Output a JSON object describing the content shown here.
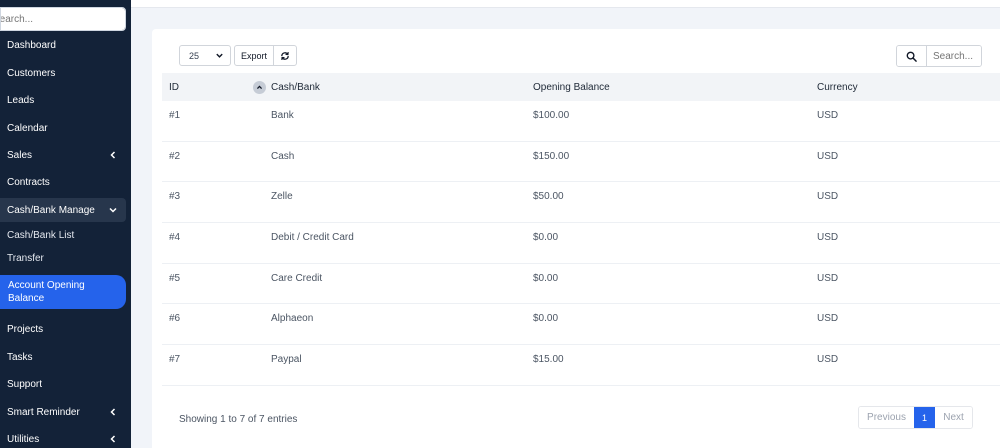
{
  "sidebar": {
    "search_placeholder": "Search...",
    "items": [
      {
        "label": "Dashboard"
      },
      {
        "label": "Customers"
      },
      {
        "label": "Leads"
      },
      {
        "label": "Calendar"
      },
      {
        "label": "Sales"
      },
      {
        "label": "Contracts"
      },
      {
        "label": "Cash/Bank Manage"
      },
      {
        "label": "Projects"
      },
      {
        "label": "Tasks"
      },
      {
        "label": "Support"
      },
      {
        "label": "Smart Reminder"
      },
      {
        "label": "Utilities"
      }
    ],
    "subitems": [
      {
        "label": "Cash/Bank List"
      },
      {
        "label": "Transfer"
      }
    ],
    "active_item": {
      "label": "Account Opening Balance"
    }
  },
  "toolbar": {
    "page_length": "25",
    "export_label": "Export",
    "search_placeholder": "Search..."
  },
  "table": {
    "columns": [
      "ID",
      "Cash/Bank",
      "Opening Balance",
      "Currency"
    ],
    "rows": [
      {
        "id": "#1",
        "cash_bank": "Bank",
        "opening_balance": "$100.00",
        "currency": "USD"
      },
      {
        "id": "#2",
        "cash_bank": "Cash",
        "opening_balance": "$150.00",
        "currency": "USD"
      },
      {
        "id": "#3",
        "cash_bank": "Zelle",
        "opening_balance": "$50.00",
        "currency": "USD"
      },
      {
        "id": "#4",
        "cash_bank": "Debit / Credit Card",
        "opening_balance": "$0.00",
        "currency": "USD"
      },
      {
        "id": "#5",
        "cash_bank": "Care Credit",
        "opening_balance": "$0.00",
        "currency": "USD"
      },
      {
        "id": "#6",
        "cash_bank": "Alphaeon",
        "opening_balance": "$0.00",
        "currency": "USD"
      },
      {
        "id": "#7",
        "cash_bank": "Paypal",
        "opening_balance": "$15.00",
        "currency": "USD"
      }
    ],
    "info": "Showing 1 to 7 of 7 entries"
  },
  "pagination": {
    "previous": "Previous",
    "current": "1",
    "next": "Next"
  },
  "colors": {
    "sidebar_bg": "#132238",
    "accent": "#2563eb"
  }
}
